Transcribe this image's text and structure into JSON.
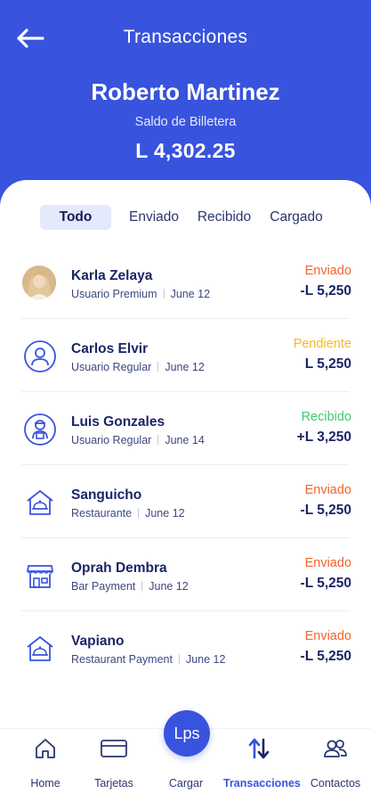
{
  "header": {
    "title": "Transacciones",
    "user_name": "Roberto Martinez",
    "balance_label": "Saldo de Billetera",
    "balance_value": "L 4,302.25"
  },
  "tabs": [
    {
      "label": "Todo",
      "active": true
    },
    {
      "label": "Enviado",
      "active": false
    },
    {
      "label": "Recibido",
      "active": false
    },
    {
      "label": "Cargado",
      "active": false
    }
  ],
  "transactions": [
    {
      "name": "Karla Zelaya",
      "subtitle": "Usuario Premium",
      "date": "June 12",
      "status": "Enviado",
      "status_color": "#f5642a",
      "amount": "-L 5,250",
      "icon": "user-photo-avatar"
    },
    {
      "name": "Carlos Elvir",
      "subtitle": "Usuario Regular",
      "date": "June 12",
      "status": "Pendiente",
      "status_color": "#f6b826",
      "amount": "L 5,250",
      "icon": "user-circle-icon"
    },
    {
      "name": "Luis Gonzales",
      "subtitle": "Usuario Regular",
      "date": "June 14",
      "status": "Recibido",
      "status_color": "#3ecb6e",
      "amount": "+L 3,250",
      "icon": "courier-icon"
    },
    {
      "name": "Sanguicho",
      "subtitle": "Restaurante",
      "date": "June 12",
      "status": "Enviado",
      "status_color": "#f5642a",
      "amount": "-L 5,250",
      "icon": "restaurant-icon"
    },
    {
      "name": "Oprah Dembra",
      "subtitle": "Bar Payment",
      "date": "June 12",
      "status": "Enviado",
      "status_color": "#f5642a",
      "amount": "-L 5,250",
      "icon": "storefront-icon"
    },
    {
      "name": "Vapiano",
      "subtitle": "Restaurant Payment",
      "date": "June 12",
      "status": "Enviado",
      "status_color": "#f5642a",
      "amount": "-L 5,250",
      "icon": "restaurant-icon"
    }
  ],
  "bottom_nav": {
    "fab_label": "Lps",
    "items": [
      {
        "label": "Home",
        "icon": "home-icon"
      },
      {
        "label": "Tarjetas",
        "icon": "card-icon"
      },
      {
        "label": "Cargar",
        "icon": "lps-button"
      },
      {
        "label": "Transacciones",
        "icon": "transfer-arrows-icon",
        "active": true
      },
      {
        "label": "Contactos",
        "icon": "contacts-icon"
      }
    ]
  },
  "colors": {
    "primary": "#3853dd",
    "sent": "#f5642a",
    "pending": "#f6b826",
    "received": "#3ecb6e",
    "text_dark": "#1b2568"
  }
}
